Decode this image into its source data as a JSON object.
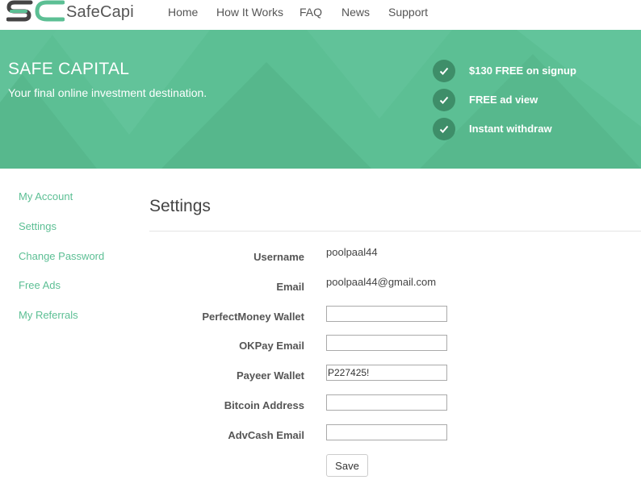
{
  "brand": {
    "name": "SafeCapi"
  },
  "nav": {
    "items": [
      "Home",
      "How It Works",
      "FAQ",
      "News",
      "Support"
    ]
  },
  "hero": {
    "title": "SAFE CAPITAL",
    "subtitle": "Your final online investment destination.",
    "features": [
      "$130 FREE on signup",
      "FREE ad view",
      "Instant withdraw"
    ]
  },
  "sidebar": {
    "items": [
      "My Account",
      "Settings",
      "Change Password",
      "Free Ads",
      "My Referrals"
    ]
  },
  "main": {
    "title": "Settings",
    "username_label": "Username",
    "username_value": "poolpaal44",
    "email_label": "Email",
    "email_value": "poolpaal44@gmail.com",
    "perfectmoney_label": "PerfectMoney Wallet",
    "perfectmoney_value": "",
    "okpay_label": "OKPay Email",
    "okpay_value": "",
    "payeer_label": "Payeer Wallet",
    "payeer_value": "P227425!",
    "bitcoin_label": "Bitcoin Address",
    "bitcoin_value": "",
    "advcash_label": "AdvCash Email",
    "advcash_value": "",
    "save_label": "Save"
  },
  "colors": {
    "accent": "#5cbf94",
    "accent_dark": "#3e8e69",
    "link": "#5cbf94"
  }
}
